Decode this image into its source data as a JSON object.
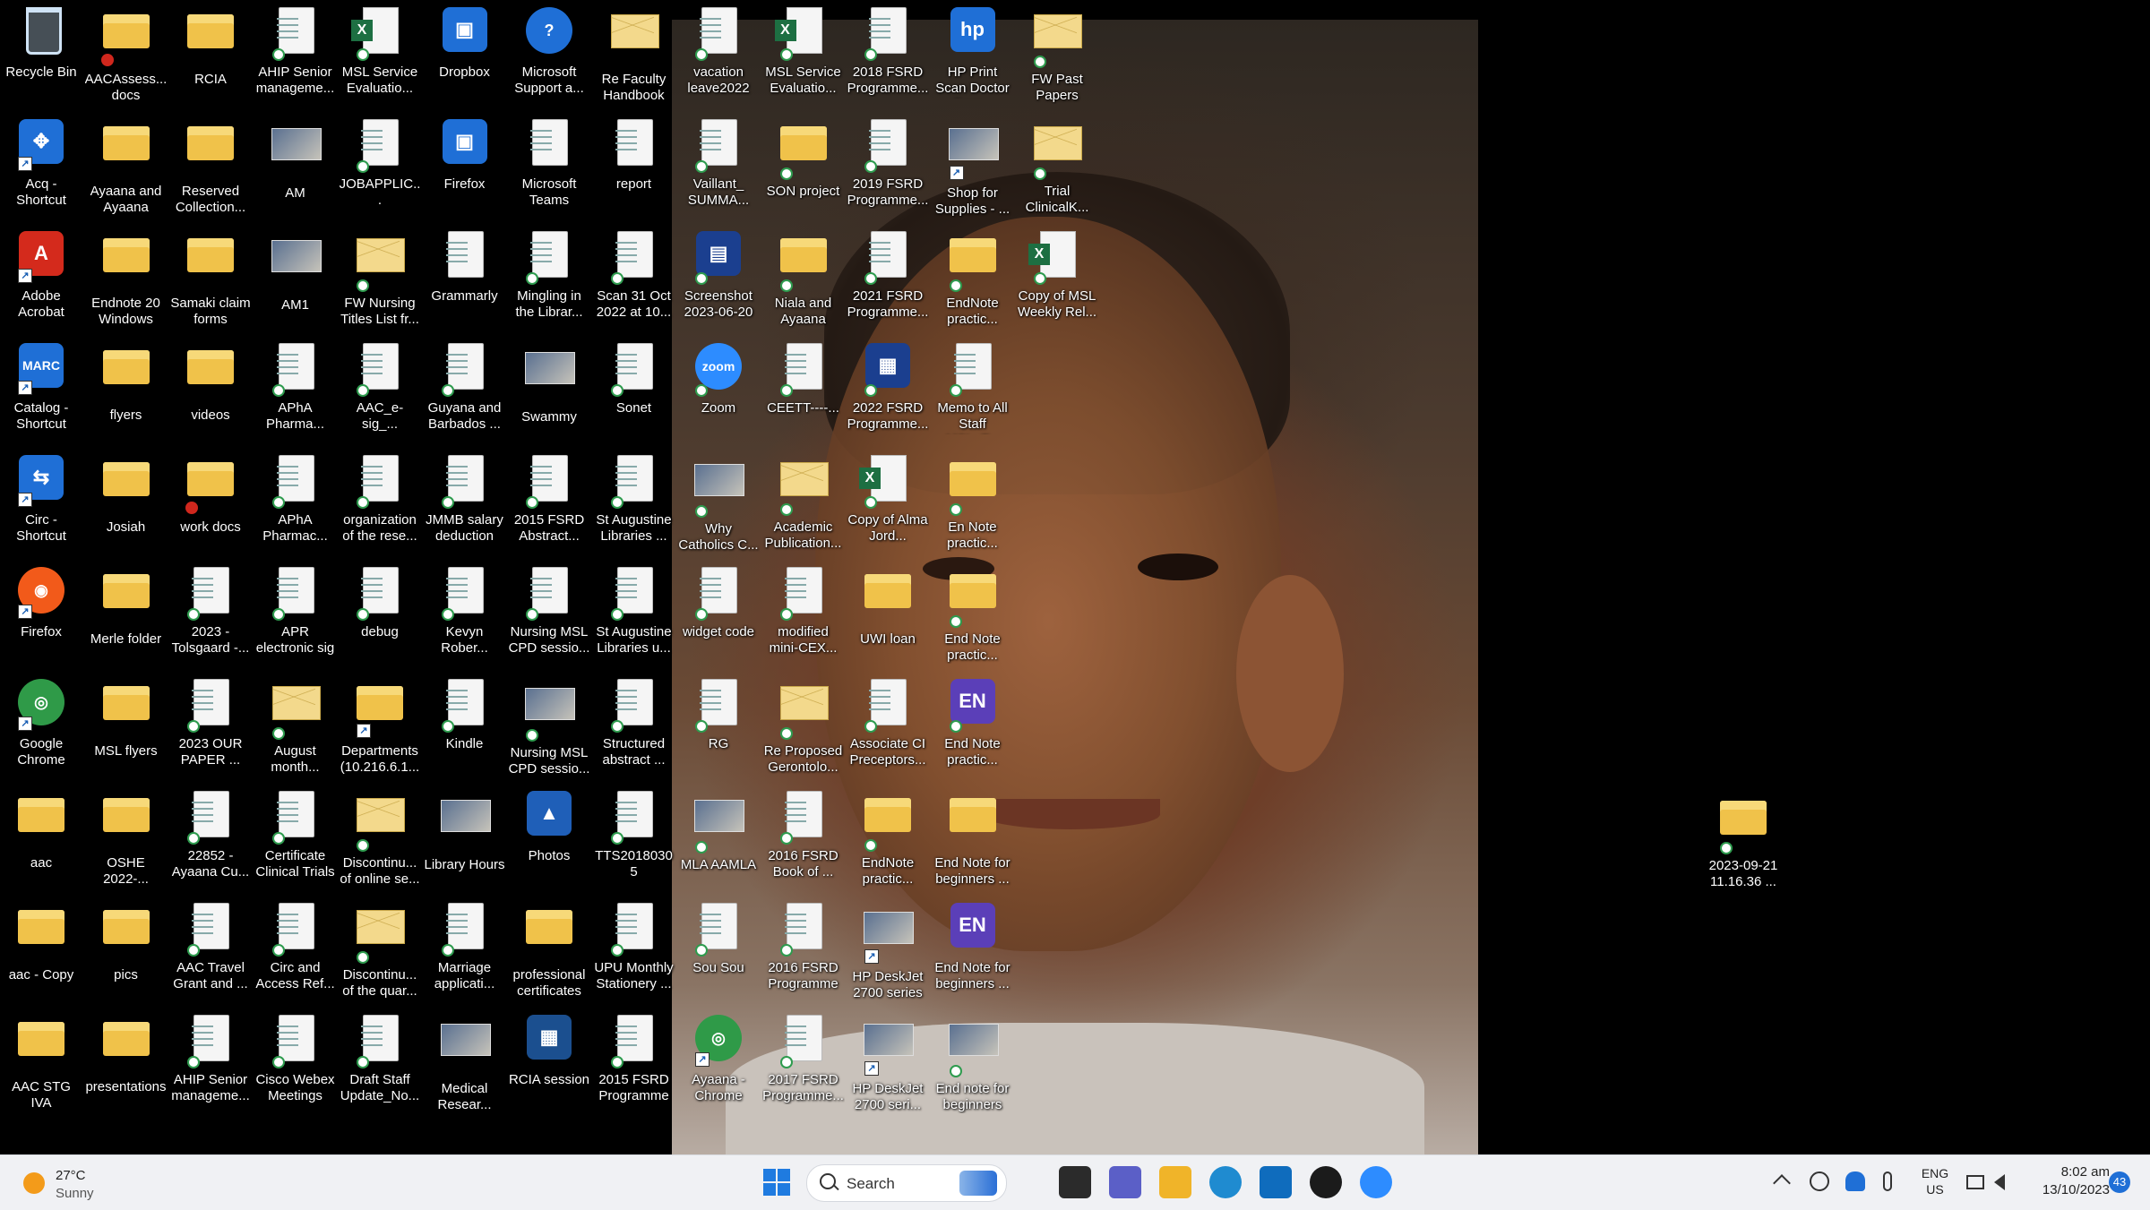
{
  "desktop": {
    "icons": [
      {
        "col": 0,
        "row": 0,
        "label": "Recycle Bin",
        "type": "bin",
        "badge": ""
      },
      {
        "col": 0,
        "row": 1,
        "label": "Acq - Shortcut",
        "type": "app",
        "glyph": "✥",
        "color": "#1f6fd6",
        "badge": "arrow"
      },
      {
        "col": 0,
        "row": 2,
        "label": "Adobe Acrobat",
        "type": "app",
        "glyph": "A",
        "color": "#d42a1c",
        "badge": "arrow"
      },
      {
        "col": 0,
        "row": 3,
        "label": "Catalog - Shortcut",
        "type": "app",
        "glyph": "MARC",
        "color": "#1f6fd6",
        "badge": "arrow"
      },
      {
        "col": 0,
        "row": 4,
        "label": "Circ - Shortcut",
        "type": "app",
        "glyph": "⇆",
        "color": "#1f6fd6",
        "badge": "arrow"
      },
      {
        "col": 0,
        "row": 5,
        "label": "Firefox",
        "type": "round",
        "glyph": "◉",
        "color": "#f25a1a",
        "badge": "arrow"
      },
      {
        "col": 0,
        "row": 6,
        "label": "Google Chrome",
        "type": "round",
        "glyph": "◎",
        "color": "#2f9a48",
        "badge": "arrow"
      },
      {
        "col": 0,
        "row": 7,
        "label": "aac",
        "type": "folder",
        "badge": ""
      },
      {
        "col": 0,
        "row": 8,
        "label": "aac - Copy",
        "type": "folder",
        "badge": ""
      },
      {
        "col": 0,
        "row": 9,
        "label": "AAC STG IVA BookGrant",
        "type": "folder",
        "badge": ""
      },
      {
        "col": 1,
        "row": 0,
        "label": "AACAssess... docs",
        "type": "folder",
        "badge": "bad"
      },
      {
        "col": 1,
        "row": 1,
        "label": "Ayaana and Ayaana paper",
        "type": "folder",
        "badge": ""
      },
      {
        "col": 1,
        "row": 2,
        "label": "Endnote 20 Windows",
        "type": "folder",
        "badge": ""
      },
      {
        "col": 1,
        "row": 3,
        "label": "flyers",
        "type": "folder",
        "badge": ""
      },
      {
        "col": 1,
        "row": 4,
        "label": "Josiah",
        "type": "folder",
        "badge": ""
      },
      {
        "col": 1,
        "row": 5,
        "label": "Merle folder",
        "type": "folder",
        "badge": ""
      },
      {
        "col": 1,
        "row": 6,
        "label": "MSL flyers",
        "type": "folder",
        "badge": ""
      },
      {
        "col": 1,
        "row": 7,
        "label": "OSHE 2022-...",
        "type": "folder",
        "badge": ""
      },
      {
        "col": 1,
        "row": 8,
        "label": "pics",
        "type": "folder",
        "badge": ""
      },
      {
        "col": 1,
        "row": 9,
        "label": "presentations",
        "type": "folder",
        "badge": ""
      },
      {
        "col": 2,
        "row": 0,
        "label": "RCIA",
        "type": "folder",
        "badge": ""
      },
      {
        "col": 2,
        "row": 1,
        "label": "Reserved Collection...",
        "type": "folder",
        "badge": ""
      },
      {
        "col": 2,
        "row": 2,
        "label": "Samaki claim forms",
        "type": "folder",
        "badge": ""
      },
      {
        "col": 2,
        "row": 3,
        "label": "videos",
        "type": "folder",
        "badge": ""
      },
      {
        "col": 2,
        "row": 4,
        "label": "work docs",
        "type": "folder",
        "badge": "bad"
      },
      {
        "col": 2,
        "row": 5,
        "label": "2023 - Tolsgaard -...",
        "type": "doc",
        "badge": "sync"
      },
      {
        "col": 2,
        "row": 6,
        "label": "2023 OUR PAPER ...",
        "type": "doc",
        "badge": "sync"
      },
      {
        "col": 2,
        "row": 7,
        "label": "22852 - Ayaana Cu...",
        "type": "doc",
        "badge": "sync"
      },
      {
        "col": 2,
        "row": 8,
        "label": "AAC Travel Grant and ...",
        "type": "doc",
        "badge": "sync"
      },
      {
        "col": 2,
        "row": 9,
        "label": "AHIP Senior manageme...",
        "type": "doc",
        "badge": "sync"
      },
      {
        "col": 3,
        "row": 0,
        "label": "AHIP Senior manageme...",
        "type": "doc",
        "badge": "sync"
      },
      {
        "col": 3,
        "row": 1,
        "label": "AM",
        "type": "img",
        "badge": ""
      },
      {
        "col": 3,
        "row": 2,
        "label": "AM1",
        "type": "img",
        "badge": ""
      },
      {
        "col": 3,
        "row": 3,
        "label": "APhA Pharma...",
        "type": "doc",
        "badge": "sync"
      },
      {
        "col": 3,
        "row": 4,
        "label": "APhA Pharmac...",
        "type": "doc",
        "badge": "sync"
      },
      {
        "col": 3,
        "row": 5,
        "label": "APR electronic sig",
        "type": "doc",
        "badge": "sync"
      },
      {
        "col": 3,
        "row": 6,
        "label": "August month...",
        "type": "mail",
        "badge": "sync"
      },
      {
        "col": 3,
        "row": 7,
        "label": "Certificate Clinical Trials",
        "type": "doc",
        "badge": "sync"
      },
      {
        "col": 3,
        "row": 8,
        "label": "Circ and Access Ref...",
        "type": "doc",
        "badge": "sync"
      },
      {
        "col": 3,
        "row": 9,
        "label": "Cisco Webex Meetings",
        "type": "doc",
        "badge": "sync"
      },
      {
        "col": 4,
        "row": 0,
        "label": "MSL Service Evaluatio...",
        "type": "excel",
        "badge": "sync"
      },
      {
        "col": 4,
        "row": 1,
        "label": "JOBAPPLIC...",
        "type": "doc",
        "badge": "sync"
      },
      {
        "col": 4,
        "row": 2,
        "label": "FW Nursing Titles List fr...",
        "type": "mail",
        "badge": "sync"
      },
      {
        "col": 4,
        "row": 3,
        "label": "AAC_e-sig_...",
        "type": "doc",
        "badge": "sync"
      },
      {
        "col": 4,
        "row": 4,
        "label": "organization of the rese...",
        "type": "doc",
        "badge": "sync"
      },
      {
        "col": 4,
        "row": 5,
        "label": "debug",
        "type": "doc",
        "badge": "sync"
      },
      {
        "col": 4,
        "row": 6,
        "label": "Departments (10.216.6.1...",
        "type": "folder",
        "badge": "arrow"
      },
      {
        "col": 4,
        "row": 7,
        "label": "Discontinu... of online se...",
        "type": "mail",
        "badge": "sync"
      },
      {
        "col": 4,
        "row": 8,
        "label": "Discontinu... of the quar...",
        "type": "mail",
        "badge": "sync"
      },
      {
        "col": 4,
        "row": 9,
        "label": "Draft Staff Update_No...",
        "type": "doc",
        "badge": "sync"
      },
      {
        "col": 5,
        "row": 0,
        "label": "Dropbox",
        "type": "app",
        "glyph": "▣",
        "color": "#1f6fd6",
        "badge": ""
      },
      {
        "col": 5,
        "row": 1,
        "label": "Firefox",
        "type": "app",
        "glyph": "▣",
        "color": "#1f6fd6",
        "badge": ""
      },
      {
        "col": 5,
        "row": 2,
        "label": "Grammarly",
        "type": "doc",
        "badge": ""
      },
      {
        "col": 5,
        "row": 3,
        "label": "Guyana and Barbados ...",
        "type": "doc",
        "badge": "sync"
      },
      {
        "col": 5,
        "row": 4,
        "label": "JMMB salary deduction",
        "type": "doc",
        "badge": "sync"
      },
      {
        "col": 5,
        "row": 5,
        "label": "Kevyn Rober...",
        "type": "doc",
        "badge": "sync"
      },
      {
        "col": 5,
        "row": 6,
        "label": "Kindle",
        "type": "doc",
        "badge": "sync"
      },
      {
        "col": 5,
        "row": 7,
        "label": "Library Hours",
        "type": "img",
        "badge": ""
      },
      {
        "col": 5,
        "row": 8,
        "label": "Marriage applicati...",
        "type": "doc",
        "badge": "sync"
      },
      {
        "col": 5,
        "row": 9,
        "label": "Medical Resear...",
        "type": "img",
        "badge": ""
      },
      {
        "col": 6,
        "row": 0,
        "label": "Microsoft Support a...",
        "type": "round",
        "glyph": "?",
        "color": "#1f6fd6",
        "badge": ""
      },
      {
        "col": 6,
        "row": 1,
        "label": "Microsoft Teams",
        "type": "doc",
        "badge": ""
      },
      {
        "col": 6,
        "row": 2,
        "label": "Mingling in the Librar...",
        "type": "doc",
        "badge": "sync"
      },
      {
        "col": 6,
        "row": 3,
        "label": "Swammy",
        "type": "img",
        "badge": ""
      },
      {
        "col": 6,
        "row": 4,
        "label": "2015 FSRD Abstract...",
        "type": "doc",
        "badge": "sync"
      },
      {
        "col": 6,
        "row": 5,
        "label": "Nursing MSL CPD sessio...",
        "type": "doc",
        "badge": "sync"
      },
      {
        "col": 6,
        "row": 6,
        "label": "Nursing MSL CPD sessio...",
        "type": "img",
        "badge": "sync"
      },
      {
        "col": 6,
        "row": 7,
        "label": "Photos",
        "type": "app",
        "glyph": "▲",
        "color": "#1f5fb8",
        "badge": ""
      },
      {
        "col": 6,
        "row": 8,
        "label": "professional certificates",
        "type": "folder",
        "badge": ""
      },
      {
        "col": 6,
        "row": 9,
        "label": "RCIA session",
        "type": "app",
        "glyph": "▦",
        "color": "#1b4f8f",
        "badge": ""
      },
      {
        "col": 7,
        "row": 0,
        "label": "Re Faculty Handbook",
        "type": "mail",
        "badge": ""
      },
      {
        "col": 7,
        "row": 1,
        "label": "report",
        "type": "doc",
        "badge": ""
      },
      {
        "col": 7,
        "row": 2,
        "label": "Scan 31 Oct 2022 at 10...",
        "type": "doc",
        "badge": "sync"
      },
      {
        "col": 7,
        "row": 3,
        "label": "Sonet",
        "type": "doc",
        "badge": "sync"
      },
      {
        "col": 7,
        "row": 4,
        "label": "St Augustine Libraries ...",
        "type": "doc",
        "badge": "sync"
      },
      {
        "col": 7,
        "row": 5,
        "label": "St Augustine Libraries u...",
        "type": "doc",
        "badge": "sync"
      },
      {
        "col": 7,
        "row": 6,
        "label": "Structured abstract ...",
        "type": "doc",
        "badge": "sync"
      },
      {
        "col": 7,
        "row": 7,
        "label": "TTS20180305",
        "type": "doc",
        "badge": "sync"
      },
      {
        "col": 7,
        "row": 8,
        "label": "UPU Monthly Stationery ...",
        "type": "doc",
        "badge": "sync"
      },
      {
        "col": 7,
        "row": 9,
        "label": "2015 FSRD Programme",
        "type": "doc",
        "badge": "sync"
      },
      {
        "col": 8,
        "row": 0,
        "label": "vacation leave2022",
        "type": "doc",
        "badge": "sync"
      },
      {
        "col": 8,
        "row": 1,
        "label": "Vaillant_ SUMMA...",
        "type": "doc",
        "badge": "sync"
      },
      {
        "col": 8,
        "row": 2,
        "label": "Screenshot 2023-06-20 ...",
        "type": "app",
        "glyph": "▤",
        "color": "#1b3f8f",
        "badge": "sync"
      },
      {
        "col": 8,
        "row": 3,
        "label": "Zoom",
        "type": "round",
        "glyph": "zoom",
        "color": "#2d8cff",
        "badge": "sync"
      },
      {
        "col": 8,
        "row": 4,
        "label": "Why Catholics C...",
        "type": "img",
        "badge": "sync"
      },
      {
        "col": 8,
        "row": 5,
        "label": "widget code",
        "type": "doc",
        "badge": "sync"
      },
      {
        "col": 8,
        "row": 6,
        "label": "RG",
        "type": "doc",
        "badge": "sync"
      },
      {
        "col": 8,
        "row": 7,
        "label": "MLA AAMLA",
        "type": "img",
        "badge": "sync"
      },
      {
        "col": 8,
        "row": 8,
        "label": "Sou Sou",
        "type": "doc",
        "badge": "sync"
      },
      {
        "col": 8,
        "row": 9,
        "label": "Ayaana - Chrome",
        "type": "round",
        "glyph": "◎",
        "color": "#2f9a48",
        "badge": "arrow"
      },
      {
        "col": 9,
        "row": 0,
        "label": "MSL Service Evaluatio...",
        "type": "excel",
        "badge": "sync"
      },
      {
        "col": 9,
        "row": 1,
        "label": "SON project",
        "type": "folder",
        "badge": "sync"
      },
      {
        "col": 9,
        "row": 2,
        "label": "Niala and Ayaana paper",
        "type": "folder",
        "badge": "sync"
      },
      {
        "col": 9,
        "row": 3,
        "label": "CEETT----...",
        "type": "doc",
        "badge": "sync"
      },
      {
        "col": 9,
        "row": 4,
        "label": "Academic Publication...",
        "type": "mail",
        "badge": "sync"
      },
      {
        "col": 9,
        "row": 5,
        "label": "modified mini-CEX...",
        "type": "doc",
        "badge": "sync"
      },
      {
        "col": 9,
        "row": 6,
        "label": "Re Proposed Gerontolo...",
        "type": "mail",
        "badge": "sync"
      },
      {
        "col": 9,
        "row": 7,
        "label": "2016 FSRD Book of ...",
        "type": "doc",
        "badge": "sync"
      },
      {
        "col": 9,
        "row": 8,
        "label": "2016 FSRD Programme",
        "type": "doc",
        "badge": "sync"
      },
      {
        "col": 9,
        "row": 9,
        "label": "2017 FSRD Programme...",
        "type": "doc",
        "badge": "sync"
      },
      {
        "col": 10,
        "row": 0,
        "label": "2018 FSRD Programme...",
        "type": "doc",
        "badge": "sync"
      },
      {
        "col": 10,
        "row": 1,
        "label": "2019 FSRD Programme...",
        "type": "doc",
        "badge": "sync"
      },
      {
        "col": 10,
        "row": 2,
        "label": "2021 FSRD Programme...",
        "type": "doc",
        "badge": "sync"
      },
      {
        "col": 10,
        "row": 3,
        "label": "2022 FSRD Programme...",
        "type": "app",
        "glyph": "▦",
        "color": "#1b3f8f",
        "badge": "sync"
      },
      {
        "col": 10,
        "row": 4,
        "label": "Copy of Alma Jord...",
        "type": "excel",
        "badge": "sync"
      },
      {
        "col": 10,
        "row": 5,
        "label": "UWI loan",
        "type": "folder",
        "badge": ""
      },
      {
        "col": 10,
        "row": 6,
        "label": "Associate CI Preceptors...",
        "type": "doc",
        "badge": "sync"
      },
      {
        "col": 10,
        "row": 7,
        "label": "EndNote practic...",
        "type": "folder",
        "badge": "sync"
      },
      {
        "col": 10,
        "row": 8,
        "label": "HP DeskJet 2700 series",
        "type": "img",
        "badge": "arrow"
      },
      {
        "col": 10,
        "row": 9,
        "label": "HP DeskJet 2700 seri...",
        "type": "img",
        "badge": "arrow"
      },
      {
        "col": 11,
        "row": 0,
        "label": "HP Print Scan Doctor Dow...",
        "type": "app",
        "glyph": "hp",
        "color": "#1f6fd6",
        "badge": ""
      },
      {
        "col": 11,
        "row": 1,
        "label": "Shop for Supplies - ...",
        "type": "img",
        "badge": "arrow"
      },
      {
        "col": 11,
        "row": 2,
        "label": "EndNote practic...",
        "type": "folder",
        "badge": "sync"
      },
      {
        "col": 11,
        "row": 3,
        "label": "Memo to All Staff MSL_T...",
        "type": "doc",
        "badge": "sync"
      },
      {
        "col": 11,
        "row": 4,
        "label": "En Note practic...",
        "type": "folder",
        "badge": "sync"
      },
      {
        "col": 11,
        "row": 5,
        "label": "End Note practic...",
        "type": "folder",
        "badge": "sync"
      },
      {
        "col": 11,
        "row": 6,
        "label": "End Note practic...",
        "type": "app",
        "glyph": "EN",
        "color": "#5b3fb8",
        "badge": "sync"
      },
      {
        "col": 11,
        "row": 7,
        "label": "End Note for beginners ...",
        "type": "folder",
        "badge": ""
      },
      {
        "col": 11,
        "row": 8,
        "label": "End Note for beginners ...",
        "type": "app",
        "glyph": "EN",
        "color": "#5b3fb8",
        "badge": ""
      },
      {
        "col": 11,
        "row": 9,
        "label": "End note for beginners",
        "type": "img",
        "badge": "sync"
      },
      {
        "col": 12,
        "row": 0,
        "label": "FW Past Papers",
        "type": "mail",
        "badge": "sync"
      },
      {
        "col": 12,
        "row": 1,
        "label": "Trial ClinicalK...",
        "type": "mail",
        "badge": "sync"
      },
      {
        "col": 12,
        "row": 2,
        "label": "Copy of MSL Weekly Rel...",
        "type": "excel",
        "badge": "sync"
      }
    ],
    "extra_icon": {
      "label": "2023-09-21 11.16.36 ...",
      "type": "folder",
      "badge": "sync"
    }
  },
  "taskbar": {
    "weather": {
      "temp": "27°C",
      "condition": "Sunny",
      "icon": "sun-icon",
      "color": "#f39b1a"
    },
    "search_placeholder": "Search",
    "apps": [
      {
        "name": "task-view-icon",
        "color": "#2b2b2b"
      },
      {
        "name": "chat-icon",
        "color": "#5b5fc7"
      },
      {
        "name": "file-explorer-icon",
        "color": "#f0b429"
      },
      {
        "name": "edge-icon",
        "color": "#1f8bd0"
      },
      {
        "name": "outlook-icon",
        "color": "#0f6cbd"
      },
      {
        "name": "media-player-icon",
        "color": "#1b1b1b"
      },
      {
        "name": "zoom-icon",
        "color": "#2d8cff"
      }
    ],
    "tray": {
      "lang_line1": "ENG",
      "lang_line2": "US",
      "time": "8:02 am",
      "date": "13/10/2023",
      "notifications": "43"
    }
  }
}
